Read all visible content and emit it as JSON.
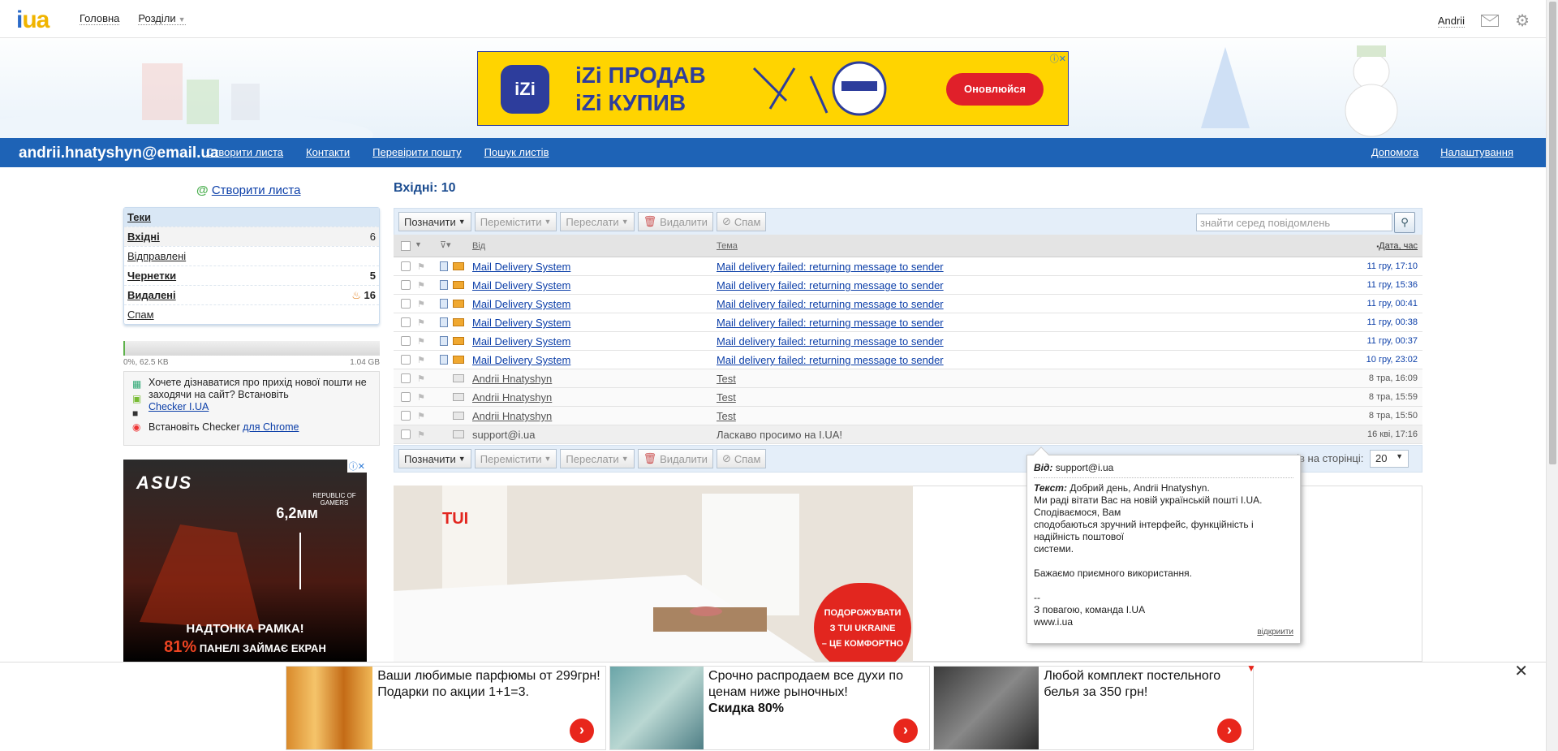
{
  "topbar": {
    "logo": "i.ua",
    "nav": [
      "Головна",
      "Розділи"
    ],
    "user": "Andrii"
  },
  "banner": {
    "line1": "iZi ПРОДАВ",
    "line2": "iZi КУПИВ",
    "cta": "Оновлюйся",
    "brand": "iZi"
  },
  "bluebar": {
    "account": "andrii.hnatyshyn@email.ua",
    "nav": [
      "Створити листа",
      "Контакти",
      "Перевірити пошту",
      "Пошук листів"
    ],
    "right": [
      "Допомога",
      "Налаштування"
    ]
  },
  "sidebar": {
    "create": "Створити листа",
    "folders_title": "Теки",
    "folders": [
      {
        "name": "Вхідні",
        "count": "6",
        "bold": true
      },
      {
        "name": "Відправлені",
        "count": "",
        "bold": false
      },
      {
        "name": "Чернетки",
        "count": "5",
        "bold": true
      },
      {
        "name": "Видалені",
        "count": "16",
        "bold": true
      },
      {
        "name": "Спам",
        "count": "",
        "bold": false
      }
    ],
    "quota_used": "0%, 62.5 KB",
    "quota_total": "1.04 GB",
    "checker_text": "Хочете дізнаватися про прихід нової пошти не заходячи на сайт? Встановіть",
    "checker_link": "Checker I.UA",
    "chrome_text": "Встановіть Checker",
    "chrome_link": "для Chrome"
  },
  "asus_ad": {
    "brand": "ASUS",
    "sub": "REPUBLIC OF GAMERS",
    "size": "6,2мм",
    "line1": "НАДТОНКА РАМКА!",
    "pct": "81%",
    "line2": "ПАНЕЛІ ЗАЙМАЄ ЕКРАН"
  },
  "mail": {
    "title": "Вхідні: 10",
    "toolbar": [
      "Позначити",
      "Перемістити",
      "Переслати",
      "Видалити",
      "Спам"
    ],
    "search_placeholder": "знайти серед повідомлень",
    "col_from": "Від",
    "col_subject": "Тема",
    "col_date": "Дата, час",
    "per_page_label": "Листів на сторінці:",
    "per_page": "20",
    "rows": [
      {
        "from": "Mail Delivery System",
        "subject": "Mail delivery failed: returning message to sender",
        "date": "11 гру, 17:10",
        "unread": true
      },
      {
        "from": "Mail Delivery System",
        "subject": "Mail delivery failed: returning message to sender",
        "date": "11 гру, 15:36",
        "unread": true
      },
      {
        "from": "Mail Delivery System",
        "subject": "Mail delivery failed: returning message to sender",
        "date": "11 гру, 00:41",
        "unread": true
      },
      {
        "from": "Mail Delivery System",
        "subject": "Mail delivery failed: returning message to sender",
        "date": "11 гру, 00:38",
        "unread": true
      },
      {
        "from": "Mail Delivery System",
        "subject": "Mail delivery failed: returning message to sender",
        "date": "11 гру, 00:37",
        "unread": true
      },
      {
        "from": "Mail Delivery System",
        "subject": "Mail delivery failed: returning message to sender",
        "date": "10 гру, 23:02",
        "unread": true
      },
      {
        "from": "Andrii Hnatyshyn",
        "subject": "Test",
        "date": "8 тра, 16:09",
        "unread": false
      },
      {
        "from": "Andrii Hnatyshyn",
        "subject": "Test",
        "date": "8 тра, 15:59",
        "unread": false
      },
      {
        "from": "Andrii Hnatyshyn",
        "subject": "Test",
        "date": "8 тра, 15:50",
        "unread": false
      },
      {
        "from": "support@i.ua",
        "subject": "Ласкаво просимо на I.UA!",
        "date": "16 кві, 17:16",
        "unread": false
      }
    ]
  },
  "tooltip": {
    "from_label": "Від:",
    "from": "support@i.ua",
    "text_label": "Текст:",
    "lines": [
      "Добрий день, Andrii Hnatyshyn.",
      "Ми раді вітати Вас на новій українській пошті I.UA. Сподіваємося, Вам",
      "сподобаються зручний інтерфейс, функційність і надійність поштової",
      "системи.",
      "",
      "Бажаємо приємного використання.",
      "",
      "--",
      "З повагою, команда I.UA",
      "www.i.ua"
    ],
    "open": "відкриити"
  },
  "tui_ad": {
    "brand": "TUI",
    "badge1": "ПОДОРОЖУВАТИ",
    "badge2": "З TUI UKRAINE",
    "badge3": "– ЦЕ КОМФОРТНО"
  },
  "bottom_ads": [
    {
      "text": "Ваши любимые парфюмы от 299грн! Подарки по акции 1+1=3.",
      "bold": ""
    },
    {
      "text": "Срочно распродаем все духи по ценам ниже рыночных!",
      "bold": "Скидка 80%"
    },
    {
      "text": "Любой комплект постельного белья за 350 грн!",
      "bold": ""
    }
  ],
  "colors": {
    "accent": "#1e63b6",
    "link": "#0b3ea8",
    "yellow": "#ffd400"
  }
}
